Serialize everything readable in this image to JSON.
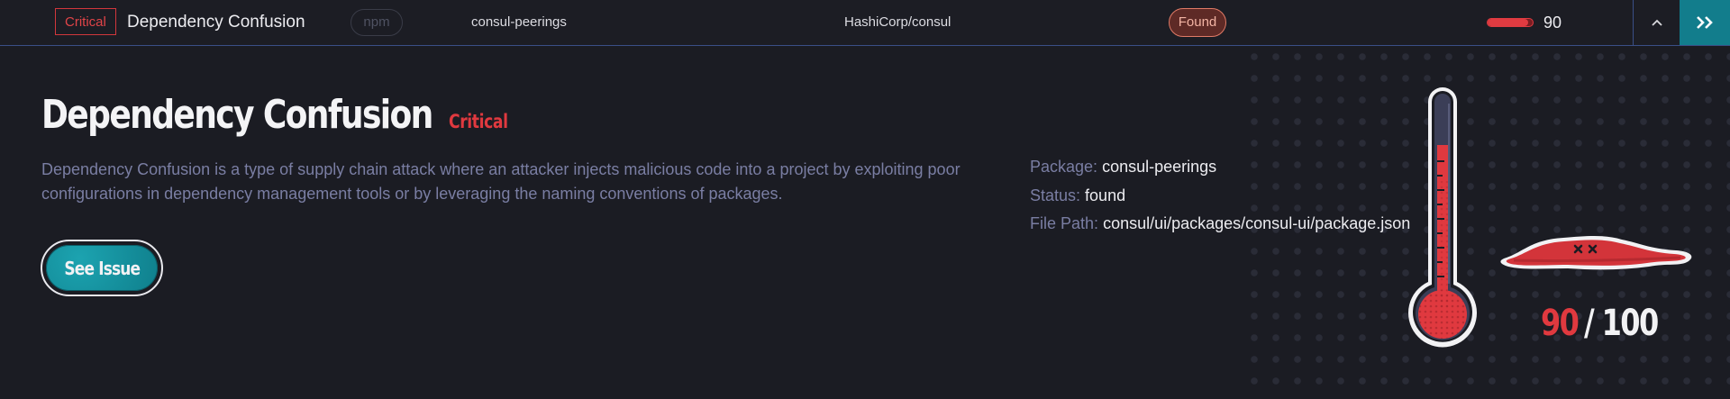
{
  "row": {
    "severity": "Critical",
    "title": "Dependency Confusion",
    "ecosystem": "npm",
    "package": "consul-peerings",
    "repository": "HashiCorp/consul",
    "status": "Found",
    "score": "90",
    "score_fraction": 0.9,
    "collapse_icon": "chevron-up-icon",
    "expand_icon": "double-chevron-right-icon"
  },
  "detail": {
    "title": "Dependency Confusion",
    "severity": "Critical",
    "description": "Dependency Confusion is a type of supply chain attack where an attacker injects malicious code into a project by exploiting poor configurations in dependency management tools or by leveraging the naming conventions of packages.",
    "button_label": "See Issue",
    "package_label": "Package:",
    "package_value": "consul-peerings",
    "status_label": "Status:",
    "status_value": "found",
    "path_label": "File Path:",
    "path_value": "consul/ui/packages/consul-ui/package.json",
    "score": "90",
    "score_max": "/ 100"
  },
  "colors": {
    "critical": "#e0393f",
    "accent": "#127d8c",
    "muted_text": "#7a7ea3",
    "background": "#1b1c23"
  }
}
